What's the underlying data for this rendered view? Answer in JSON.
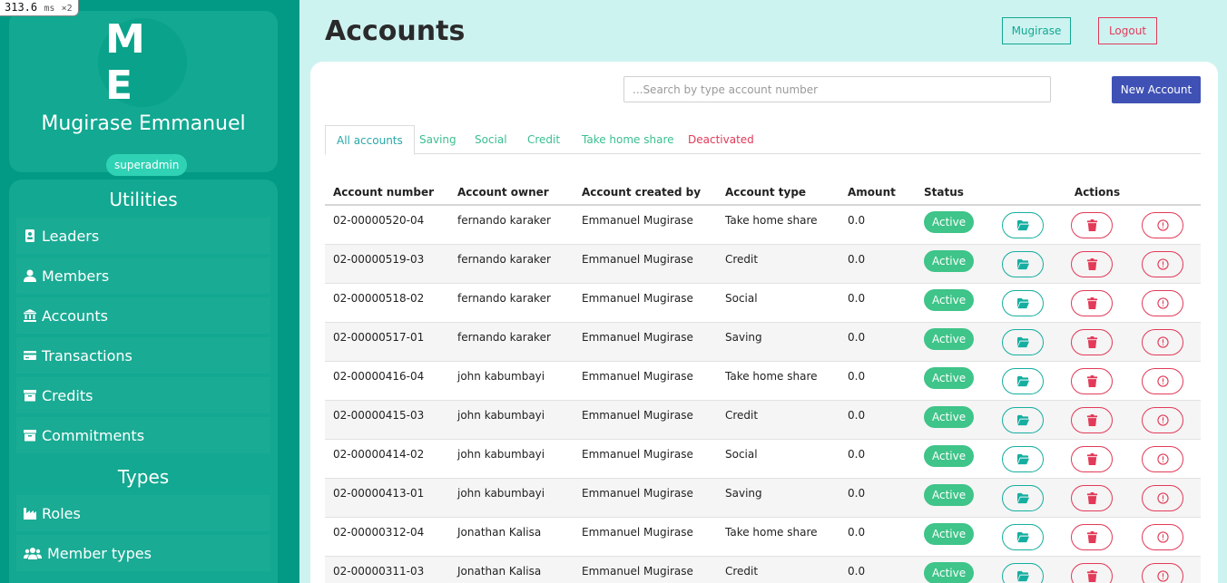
{
  "perf": {
    "value": "313.6",
    "unit": "ms",
    "mult": "×2"
  },
  "profile": {
    "initials": "M E",
    "name": "Mugirase Emmanuel",
    "role": "superadmin"
  },
  "utilities": {
    "title": "Utilities",
    "items": [
      {
        "label": "Leaders",
        "icon": "id-badge-icon"
      },
      {
        "label": "Members",
        "icon": "user-icon"
      },
      {
        "label": "Accounts",
        "icon": "bank-icon"
      },
      {
        "label": "Transactions",
        "icon": "credit-card-icon"
      },
      {
        "label": "Credits",
        "icon": "archive-icon"
      },
      {
        "label": "Commitments",
        "icon": "archive-icon"
      }
    ]
  },
  "types": {
    "title": "Types",
    "items": [
      {
        "label": "Roles",
        "icon": "industry-icon"
      },
      {
        "label": "Member types",
        "icon": "users-icon"
      }
    ]
  },
  "header": {
    "title": "Accounts",
    "user_button": "Mugirase",
    "logout_button": "Logout"
  },
  "toolbar": {
    "search_placeholder": "...Search by type account number",
    "new_account": "New Account"
  },
  "tabs": [
    {
      "label": "All accounts",
      "active": true
    },
    {
      "label": "Saving"
    },
    {
      "label": "Social"
    },
    {
      "label": "Credit"
    },
    {
      "label": "Take home share"
    },
    {
      "label": "Deactivated",
      "danger": true
    }
  ],
  "table": {
    "headers": [
      "Account number",
      "Account owner",
      "Account created by",
      "Account type",
      "Amount",
      "Status",
      "Actions"
    ],
    "rows": [
      [
        "02-00000520-04",
        "fernando karaker",
        "Emmanuel Mugirase",
        "Take home share",
        "0.0",
        "Active"
      ],
      [
        "02-00000519-03",
        "fernando karaker",
        "Emmanuel Mugirase",
        "Credit",
        "0.0",
        "Active"
      ],
      [
        "02-00000518-02",
        "fernando karaker",
        "Emmanuel Mugirase",
        "Social",
        "0.0",
        "Active"
      ],
      [
        "02-00000517-01",
        "fernando karaker",
        "Emmanuel Mugirase",
        "Saving",
        "0.0",
        "Active"
      ],
      [
        "02-00000416-04",
        "john kabumbayi",
        "Emmanuel Mugirase",
        "Take home share",
        "0.0",
        "Active"
      ],
      [
        "02-00000415-03",
        "john kabumbayi",
        "Emmanuel Mugirase",
        "Credit",
        "0.0",
        "Active"
      ],
      [
        "02-00000414-02",
        "john kabumbayi",
        "Emmanuel Mugirase",
        "Social",
        "0.0",
        "Active"
      ],
      [
        "02-00000413-01",
        "john kabumbayi",
        "Emmanuel Mugirase",
        "Saving",
        "0.0",
        "Active"
      ],
      [
        "02-00000312-04",
        "Jonathan Kalisa",
        "Emmanuel Mugirase",
        "Take home share",
        "0.0",
        "Active"
      ],
      [
        "02-00000311-03",
        "Jonathan Kalisa",
        "Emmanuel Mugirase",
        "Credit",
        "0.0",
        "Active"
      ]
    ]
  },
  "colors": {
    "sidebar": "#029a84",
    "panel": "#12a891",
    "accent": "#12a891",
    "danger": "#e23a58",
    "primary": "#3f51b5",
    "active_status": "#3fc489",
    "background": "#cdf3f1"
  }
}
